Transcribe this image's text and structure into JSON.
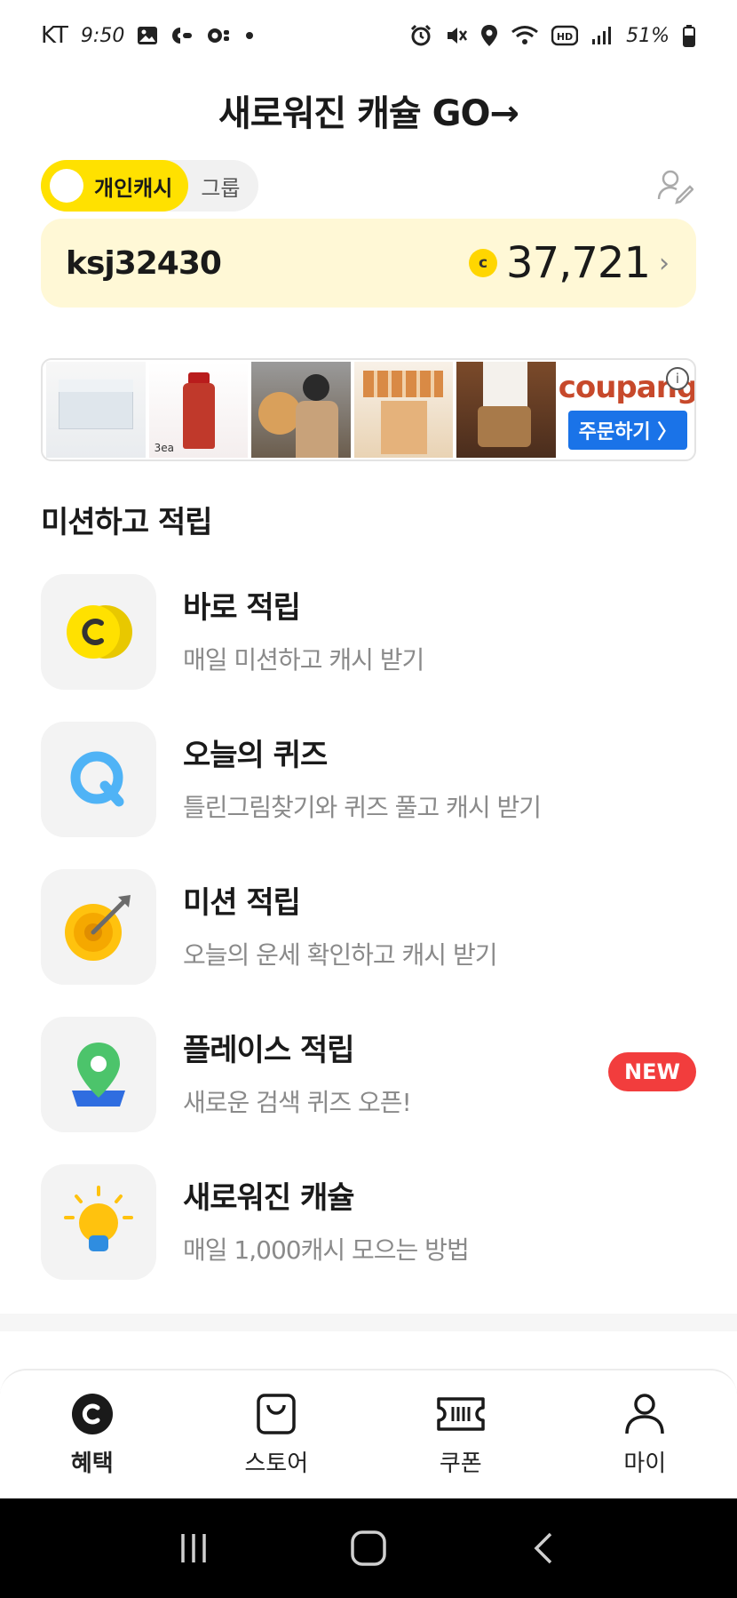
{
  "status_bar": {
    "carrier": "KT",
    "time": "9:50",
    "battery": "51%",
    "icons": [
      "gallery-icon",
      "app-icon",
      "app2-icon",
      "dot-icon",
      "alarm-icon",
      "mute-icon",
      "location-icon",
      "wifi-icon",
      "hd-icon",
      "signal-icon",
      "battery-icon"
    ]
  },
  "header": {
    "banner_title": "새로워진 캐슐  GO→"
  },
  "toggle": {
    "personal_label": "개인캐시",
    "group_label": "그룹"
  },
  "balance": {
    "username": "ksj32430",
    "coin_symbol": "c",
    "amount": "37,721"
  },
  "ad": {
    "brand": "coupang",
    "order_label": "주문하기 〉",
    "info_label": "i",
    "thumb_caption": "3ea"
  },
  "section": {
    "title": "미션하고 적립"
  },
  "missions": [
    {
      "title": "바로 적립",
      "desc": "매일 미션하고 캐시 받기",
      "icon": "coin-icon"
    },
    {
      "title": "오늘의 퀴즈",
      "desc": "틀린그림찾기와 퀴즈 풀고 캐시 받기",
      "icon": "quiz-q-icon"
    },
    {
      "title": "미션 적립",
      "desc": "오늘의 운세 확인하고 캐시 받기",
      "icon": "target-icon"
    },
    {
      "title": "플레이스 적립",
      "desc": "새로운 검색 퀴즈 오픈!",
      "icon": "map-pin-icon",
      "badge": "NEW"
    },
    {
      "title": "새로워진 캐슐",
      "desc": "매일 1,000캐시 모으는 방법",
      "icon": "lightbulb-icon"
    }
  ],
  "bottom_nav": [
    {
      "label": "혜택",
      "icon": "benefit-coin-icon",
      "active": true
    },
    {
      "label": "스토어",
      "icon": "shopping-bag-icon",
      "active": false
    },
    {
      "label": "쿠폰",
      "icon": "coupon-ticket-icon",
      "active": false
    },
    {
      "label": "마이",
      "icon": "person-icon",
      "active": false
    }
  ],
  "colors": {
    "accent_yellow": "#ffe100",
    "card_bg": "#fff8d6",
    "badge_red": "#f23d3d",
    "coupang_blue": "#1a73e8"
  }
}
